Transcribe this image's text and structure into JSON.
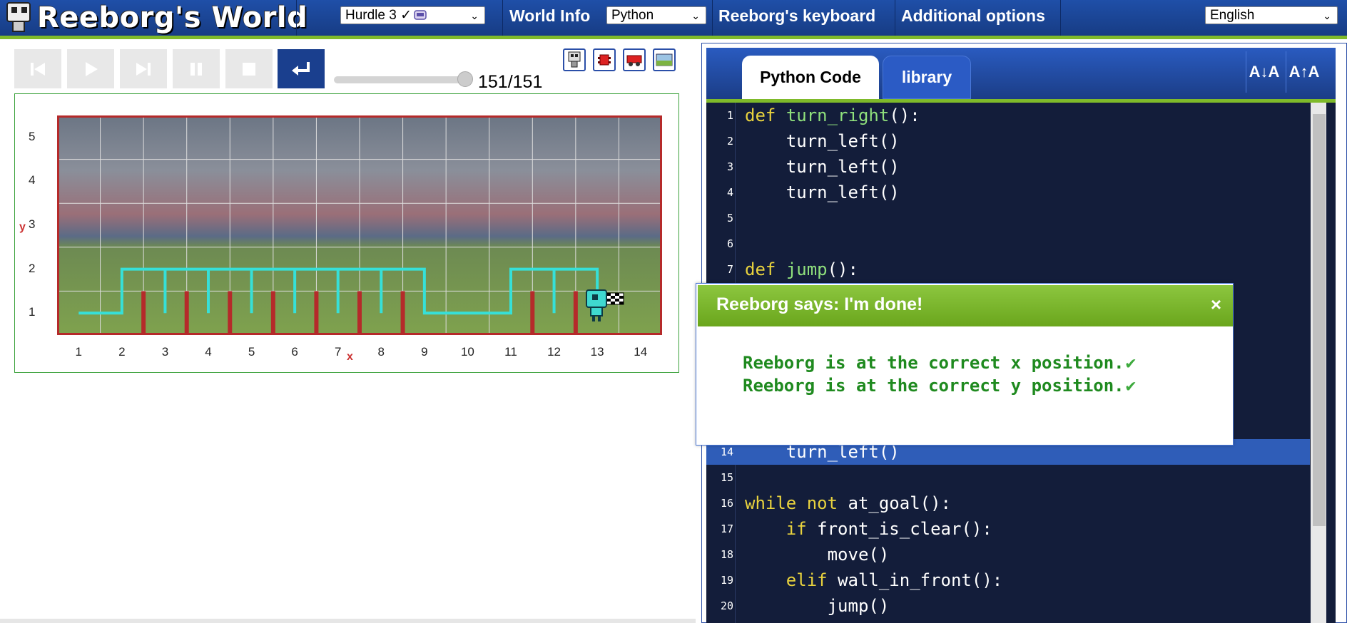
{
  "app": {
    "title": "Reeborg's World"
  },
  "topbar": {
    "world_select": "Hurdle 3 ✓",
    "world_info": "World Info",
    "language_select": "Python",
    "keyboard": "Reeborg's keyboard",
    "additional": "Additional options",
    "ui_language": "English"
  },
  "controls": {
    "buttons": [
      "reload",
      "run",
      "step",
      "pause",
      "stop",
      "edit-return"
    ],
    "step_current": 151,
    "step_total": 151,
    "step_text": "151/151",
    "progress_fraction": 1.0
  },
  "world": {
    "x_labels": [
      "1",
      "2",
      "3",
      "4",
      "5",
      "6",
      "7",
      "8",
      "9",
      "10",
      "11",
      "12",
      "13",
      "14"
    ],
    "y_labels": [
      "1",
      "2",
      "3",
      "4",
      "5"
    ],
    "x_axis_letter": "x",
    "y_axis_letter": "y",
    "walls_at_x_after": [
      2,
      3,
      4,
      5,
      6,
      7,
      8,
      11,
      12
    ],
    "robot": {
      "x": 13,
      "y": 1
    },
    "goal": {
      "x": 13,
      "y": 1
    }
  },
  "editor": {
    "tabs": [
      "Python Code",
      "library"
    ],
    "active_tab": "Python Code",
    "font_down": "A↓A",
    "font_up": "A↑A",
    "highlight_line": 14,
    "lines": [
      {
        "n": "1",
        "code": "def turn_right():"
      },
      {
        "n": "2",
        "code": "    turn_left()"
      },
      {
        "n": "3",
        "code": "    turn_left()"
      },
      {
        "n": "4",
        "code": "    turn_left()"
      },
      {
        "n": "5",
        "code": ""
      },
      {
        "n": "6",
        "code": ""
      },
      {
        "n": "7",
        "code": "def jump():"
      },
      {
        "n": "14",
        "code": "    turn_left()"
      },
      {
        "n": "15",
        "code": ""
      },
      {
        "n": "16",
        "code": "while not at_goal():"
      },
      {
        "n": "17",
        "code": "    if front_is_clear():"
      },
      {
        "n": "18",
        "code": "        move()"
      },
      {
        "n": "19",
        "code": "    elif wall_in_front():"
      },
      {
        "n": "20",
        "code": "        jump()"
      }
    ]
  },
  "dialog": {
    "title": "Reeborg says: I'm done!",
    "close": "×",
    "messages": [
      "Reeborg is at the correct x position.",
      "Reeborg is at the correct y position."
    ],
    "check": "✔"
  },
  "colors": {
    "topbar": "#1f4fa8",
    "accent_green": "#7fba2a",
    "editor_bg": "#131d3a",
    "keyword": "#e9d33e",
    "function": "#8fe07c",
    "wall": "#b52a2a",
    "trace": "#36e0d8"
  }
}
